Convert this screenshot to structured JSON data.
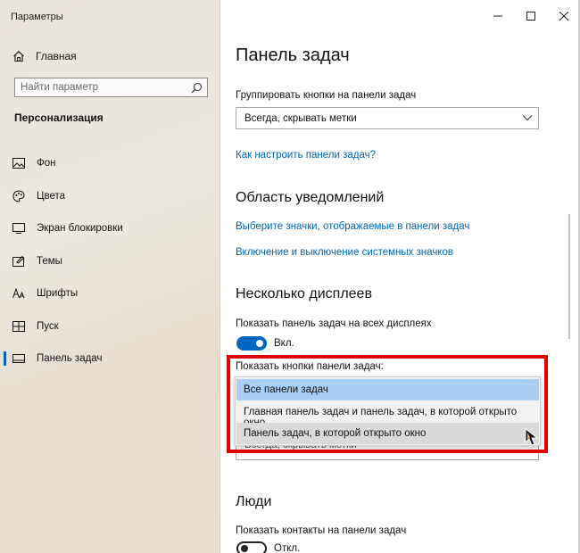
{
  "window": {
    "title": "Параметры",
    "controls": {
      "minimize": "—",
      "maximize": "□",
      "close": "✕"
    }
  },
  "sidebar": {
    "home": "Главная",
    "search_placeholder": "Найти параметр",
    "section": "Персонализация",
    "items": [
      {
        "label": "Фон",
        "icon": "image-icon"
      },
      {
        "label": "Цвета",
        "icon": "palette-icon"
      },
      {
        "label": "Экран блокировки",
        "icon": "lock-screen-icon"
      },
      {
        "label": "Темы",
        "icon": "themes-icon"
      },
      {
        "label": "Шрифты",
        "icon": "font-icon"
      },
      {
        "label": "Пуск",
        "icon": "start-icon"
      },
      {
        "label": "Панель задач",
        "icon": "taskbar-icon",
        "active": true
      }
    ]
  },
  "main": {
    "title": "Панель задач",
    "group_label": "Группировать кнопки на панели задач",
    "group_value": "Всегда, скрывать метки",
    "howto_link": "Как настроить панели задач?",
    "notify_heading": "Область уведомлений",
    "notify_link1": "Выберите значки, отображаемые в панели задач",
    "notify_link2": "Включение и выключение системных значков",
    "multi_heading": "Несколько дисплеев",
    "show_all_label": "Показать панель задач на всех дисплеях",
    "toggle_on_label": "Вкл.",
    "show_buttons_label": "Показать кнопки панели задач:",
    "dropdown_under": "Всегда, скрывать метки",
    "dropdown_options": [
      "Все панели задач",
      "Главная панель задач и панель задач, в которой открыто окно",
      "Панель задач, в которой открыто окно"
    ],
    "people_heading": "Люди",
    "people_label": "Показать контакты на панели задач",
    "toggle_off_label": "Откл."
  },
  "colors": {
    "accent": "#0067c0",
    "highlight": "#e00000",
    "link": "#0066b4"
  }
}
